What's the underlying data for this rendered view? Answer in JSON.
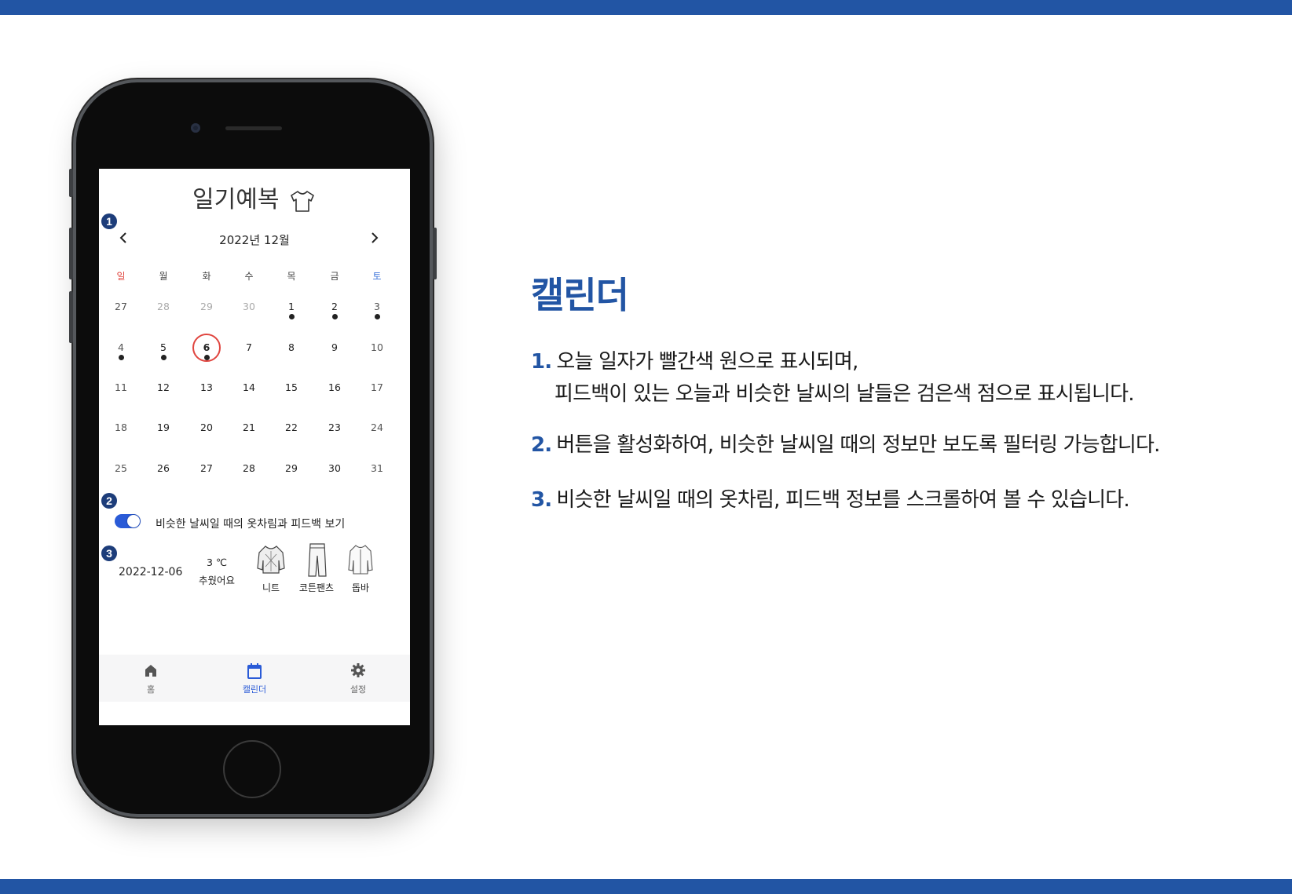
{
  "app": {
    "title": "일기예복",
    "month_label": "2022년 12월",
    "prev_icon": "chevron-left-icon",
    "next_icon": "chevron-right-icon",
    "weekdays": [
      "일",
      "월",
      "화",
      "수",
      "목",
      "금",
      "토"
    ],
    "colors": {
      "sunday": "#e0453f",
      "saturday": "#3b73d9",
      "accent": "#2a5bd7",
      "today_ring": "#e0453f"
    },
    "weeks": [
      [
        "27",
        "28",
        "29",
        "30",
        "1",
        "2",
        "3"
      ],
      [
        "4",
        "5",
        "6",
        "7",
        "8",
        "9",
        "10"
      ],
      [
        "11",
        "12",
        "13",
        "14",
        "15",
        "16",
        "17"
      ],
      [
        "18",
        "19",
        "20",
        "21",
        "22",
        "23",
        "24"
      ],
      [
        "25",
        "26",
        "27",
        "28",
        "29",
        "30",
        "31"
      ]
    ],
    "today": "6",
    "toggle_label": "비슷한 날씨일 때의 옷차림과 피드백 보기",
    "toggle_on": true,
    "entry": {
      "date": "2022-12-06",
      "temperature": "3 ℃",
      "feeling": "추웠어요",
      "clothes": [
        "니트",
        "코튼팬츠",
        "돕바"
      ]
    },
    "tabs": [
      {
        "label": "홈",
        "icon": "home-icon"
      },
      {
        "label": "캘린더",
        "icon": "calendar-icon"
      },
      {
        "label": "설정",
        "icon": "gear-icon"
      }
    ],
    "active_tab": "캘린더"
  },
  "badges": [
    "1",
    "2",
    "3"
  ],
  "description": {
    "heading": "캘린더",
    "items": [
      {
        "num": "1.",
        "line1": "오늘 일자가 빨간색 원으로 표시되며,",
        "line2": "피드백이 있는 오늘과 비슷한 날씨의 날들은 검은색 점으로 표시됩니다."
      },
      {
        "num": "2.",
        "line1": "버튼을 활성화하여, 비슷한 날씨일 때의 정보만 보도록 필터링 가능합니다."
      },
      {
        "num": "3.",
        "line1": "비슷한 날씨일 때의 옷차림, 피드백 정보를 스크롤하여 볼 수 있습니다."
      }
    ]
  },
  "theme": {
    "brand": "#2255a4"
  }
}
